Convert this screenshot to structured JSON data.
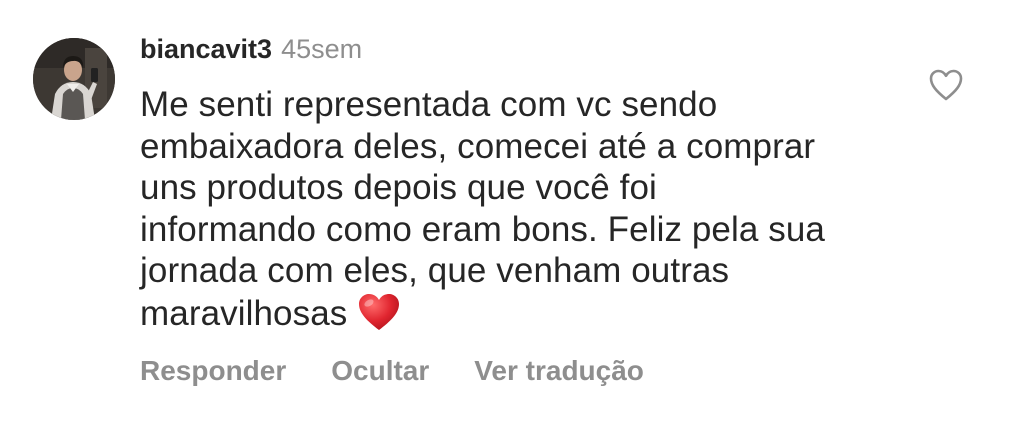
{
  "comment": {
    "username": "biancavit3",
    "time": "45sem",
    "lines": [
      "Me senti representada com vc sendo",
      "embaixadora deles, comecei até a comprar",
      "uns produtos depois que você foi",
      "informando como eram bons. Feliz pela sua",
      "jornada com eles, que venham outras",
      "maravilhosas"
    ],
    "emoji": "red-heart-emoji"
  },
  "actions": {
    "reply": "Responder",
    "hide": "Ocultar",
    "translate": "Ver tradução"
  },
  "icons": {
    "like": "heart-outline-icon"
  },
  "colors": {
    "text": "#262626",
    "muted": "#8e8e8e",
    "heart": "#e0252f"
  }
}
